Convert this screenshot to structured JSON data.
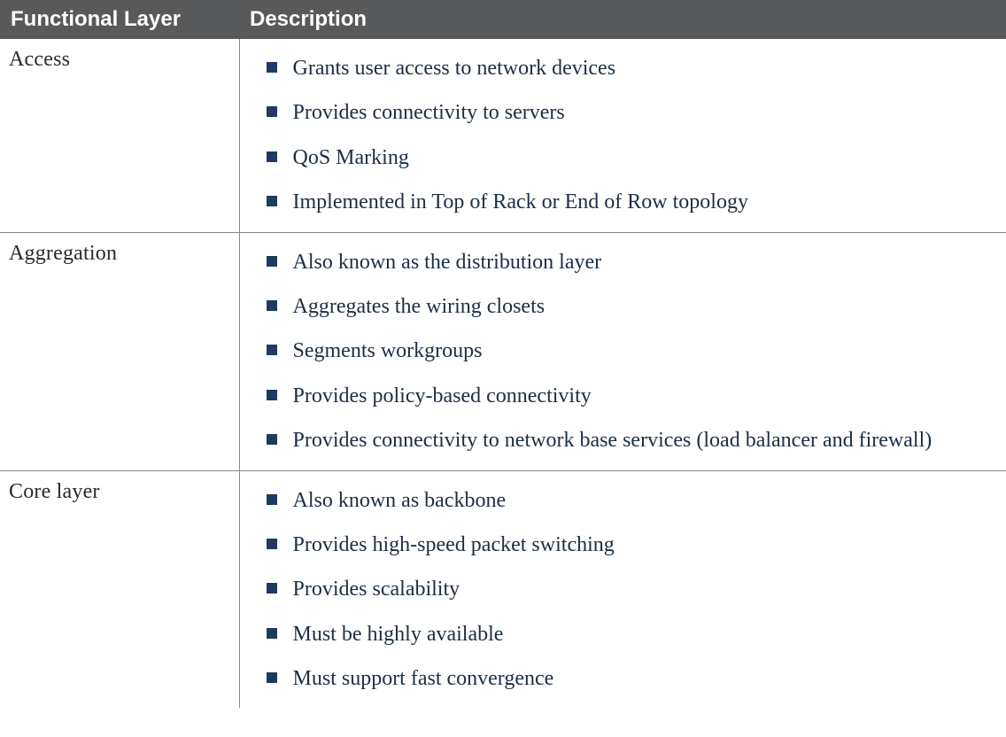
{
  "table": {
    "headers": {
      "layer": "Functional Layer",
      "description": "Description"
    },
    "rows": [
      {
        "layer": "Access",
        "items": [
          "Grants user access to network devices",
          "Provides connectivity to servers",
          "QoS Marking",
          "Implemented in Top of Rack or End of Row topology"
        ]
      },
      {
        "layer": "Aggregation",
        "items": [
          "Also known as the distribution layer",
          "Aggregates the wiring closets",
          "Segments workgroups",
          "Provides policy-based connectivity",
          "Provides connectivity to network base services (load balancer and firewall)"
        ]
      },
      {
        "layer": "Core layer",
        "items": [
          "Also known as backbone",
          "Provides high-speed packet switching",
          "Provides scalability",
          "Must be highly available",
          "Must support fast convergence"
        ]
      }
    ]
  }
}
